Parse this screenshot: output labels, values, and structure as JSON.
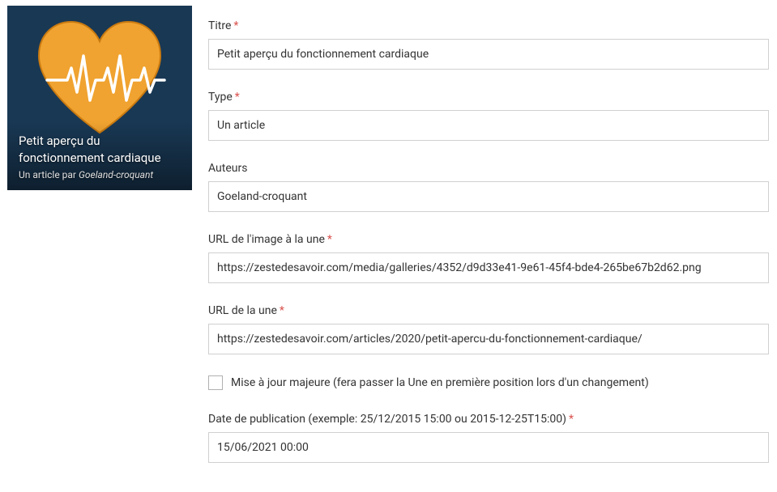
{
  "card": {
    "title": "Petit aperçu du fonctionnement cardiaque",
    "subtitle_prefix": "Un article par ",
    "subtitle_author": "Goeland-croquant"
  },
  "form": {
    "titre": {
      "label": "Titre",
      "value": "Petit aperçu du fonctionnement cardiaque"
    },
    "type": {
      "label": "Type",
      "value": "Un article"
    },
    "auteurs": {
      "label": "Auteurs",
      "value": "Goeland-croquant"
    },
    "image_url": {
      "label": "URL de l'image à la une",
      "value": "https://zestedesavoir.com/media/galleries/4352/d9d33e41-9e61-45f4-bde4-265be67b2d62.png"
    },
    "url": {
      "label": "URL de la une",
      "value": "https://zestedesavoir.com/articles/2020/petit-apercu-du-fonctionnement-cardiaque/"
    },
    "major_update": {
      "label": "Mise à jour majeure (fera passer la Une en première position lors d'un changement)",
      "checked": false
    },
    "pubdate": {
      "label": "Date de publication (exemple: 25/12/2015 15:00 ou 2015-12-25T15:00)",
      "value": "15/06/2021 00:00"
    }
  }
}
